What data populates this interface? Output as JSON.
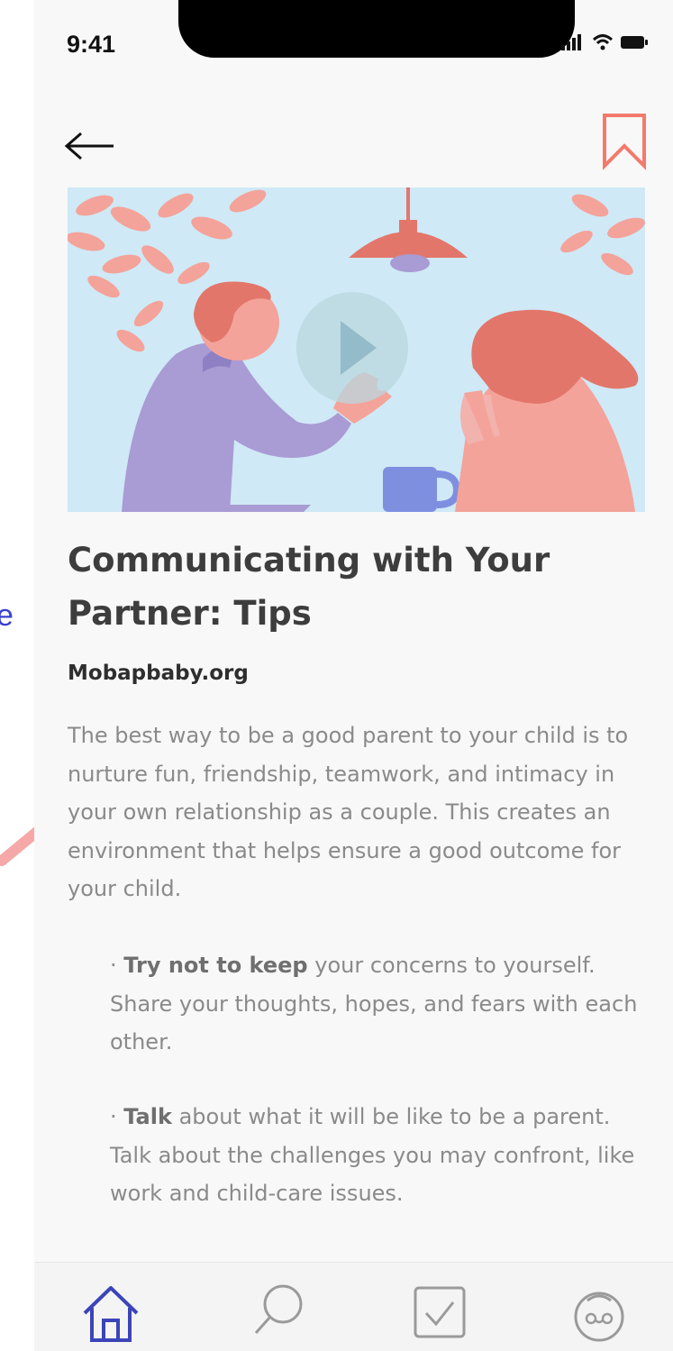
{
  "status_bar": {
    "time": "9:41"
  },
  "annotation": {
    "fragment": "e"
  },
  "article": {
    "title": "Communicating with Your Partner: Tips",
    "source": "Mobapbaby.org",
    "intro": "The best way to be a good parent to your child is to nurture fun, friendship, teamwork, and intimacy in your own relationship as a couple. This creates an environment that helps ensure a good outcome for your child.",
    "tips": [
      {
        "lead": "Try not to keep",
        "rest": " your concerns to yourself. Share your thoughts, hopes, and fears with each other."
      },
      {
        "lead": "Talk",
        "rest": " about what it will be like to be a parent. Talk about the challenges you may confront, like work and child-care issues."
      }
    ]
  },
  "icons": {
    "back": "back-arrow-icon",
    "bookmark": "bookmark-icon",
    "play": "play-icon",
    "nav": [
      "home-icon",
      "search-icon",
      "checklist-icon",
      "baby-face-icon"
    ]
  },
  "colors": {
    "accent": "#f27b6c",
    "nav_active": "#3b44b8",
    "nav_inactive": "#9a9a9a",
    "hero_bg": "#cfe9f6"
  }
}
